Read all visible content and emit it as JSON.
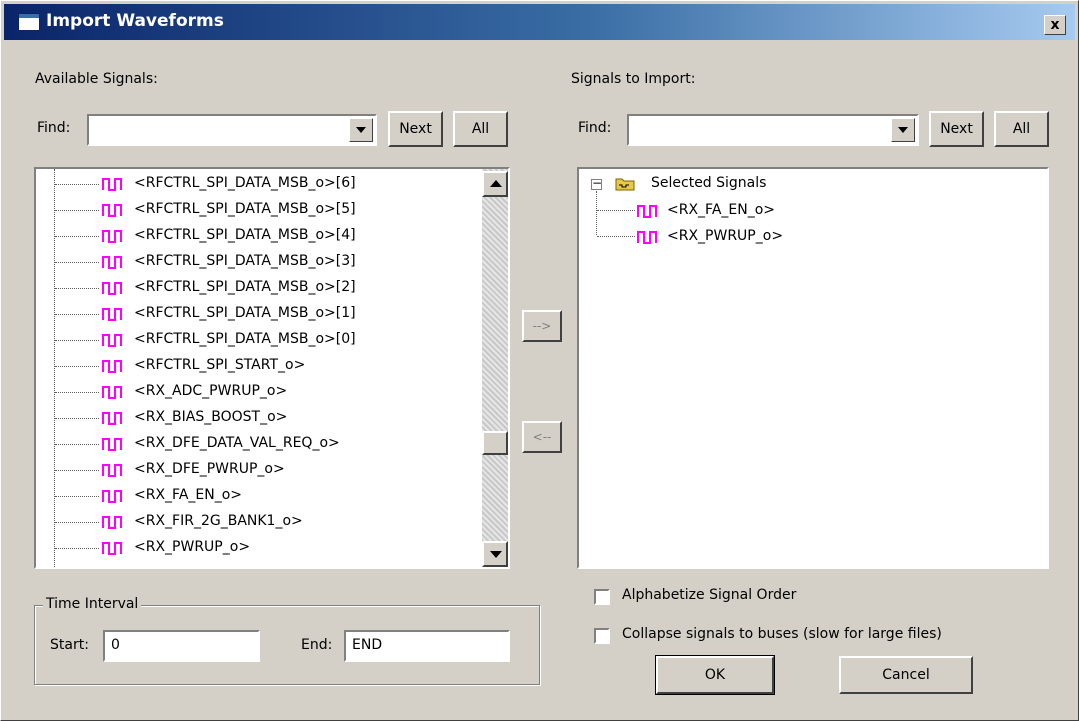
{
  "window": {
    "title": "Import Waveforms",
    "close_label": "x"
  },
  "left": {
    "heading": "Available Signals:",
    "find_label": "Find:",
    "find_value": "",
    "next_label": "Next",
    "all_label": "All",
    "signals": [
      "<RFCTRL_SPI_DATA_MSB_o>[6]",
      "<RFCTRL_SPI_DATA_MSB_o>[5]",
      "<RFCTRL_SPI_DATA_MSB_o>[4]",
      "<RFCTRL_SPI_DATA_MSB_o>[3]",
      "<RFCTRL_SPI_DATA_MSB_o>[2]",
      "<RFCTRL_SPI_DATA_MSB_o>[1]",
      "<RFCTRL_SPI_DATA_MSB_o>[0]",
      "<RFCTRL_SPI_START_o>",
      "<RX_ADC_PWRUP_o>",
      "<RX_BIAS_BOOST_o>",
      "<RX_DFE_DATA_VAL_REQ_o>",
      "<RX_DFE_PWRUP_o>",
      "<RX_FA_EN_o>",
      "<RX_FIR_2G_BANK1_o>",
      "<RX_PWRUP_o>"
    ]
  },
  "middle": {
    "add_label": "-->",
    "remove_label": "<--"
  },
  "right": {
    "heading": "Signals to Import:",
    "find_label": "Find:",
    "find_value": "",
    "next_label": "Next",
    "all_label": "All",
    "root_label": "Selected Signals",
    "signals": [
      "<RX_FA_EN_o>",
      "<RX_PWRUP_o>"
    ]
  },
  "time_interval": {
    "title": "Time Interval",
    "start_label": "Start:",
    "start_value": "0",
    "end_label": "End:",
    "end_value": "END"
  },
  "options": {
    "alphabetize_label": "Alphabetize Signal Order",
    "alphabetize_checked": false,
    "collapse_label": "Collapse signals to buses (slow for large files)",
    "collapse_checked": false
  },
  "buttons": {
    "ok_label": "OK",
    "cancel_label": "Cancel"
  },
  "colors": {
    "signal_icon": "#ff00ff",
    "title_start": "#0a246a",
    "title_end": "#a6caf0",
    "folder": "#e8c848"
  }
}
